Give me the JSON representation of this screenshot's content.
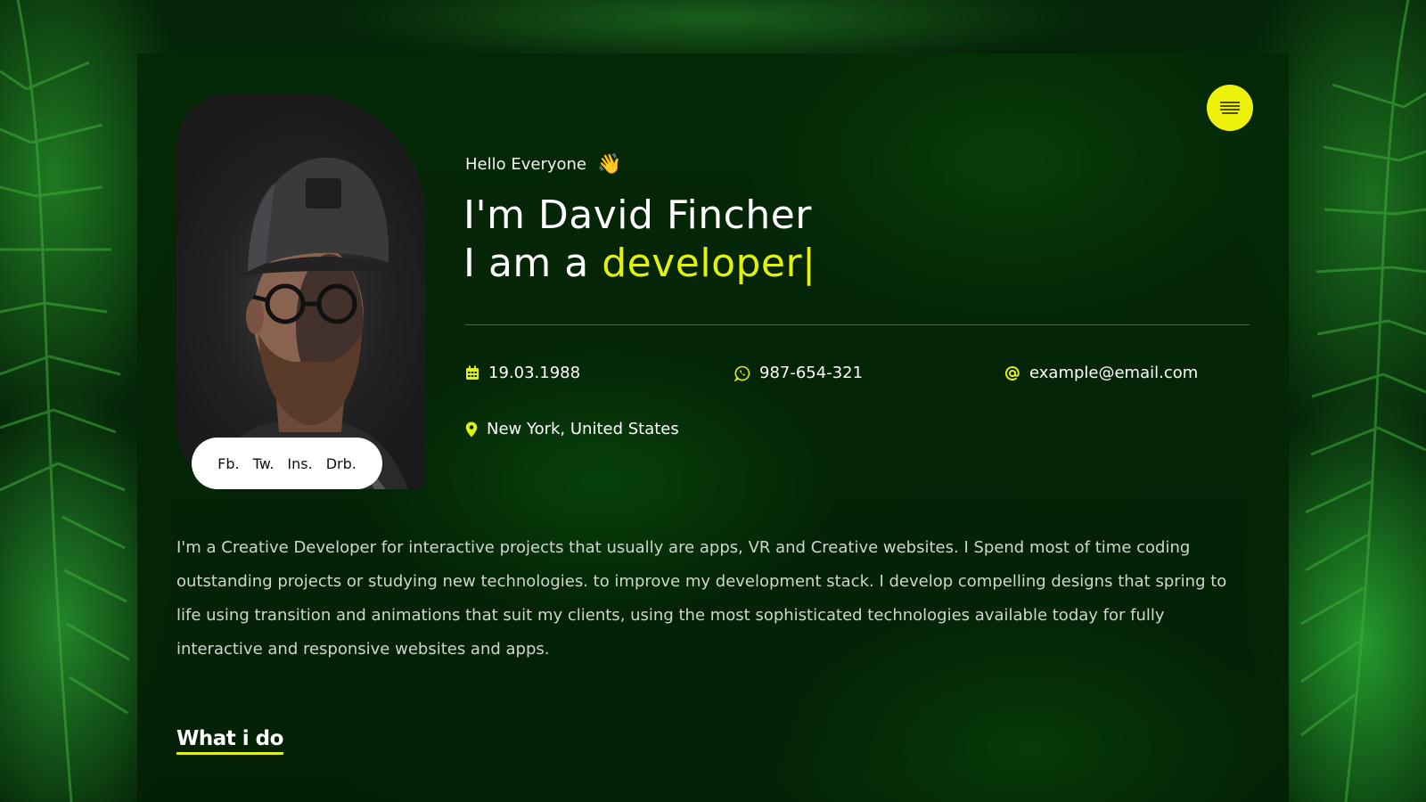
{
  "colors": {
    "accent": "#e2f20a",
    "menu_button": "#eef20a",
    "background": "#052508"
  },
  "social": {
    "items": [
      "Fb.",
      "Tw.",
      "Ins.",
      "Drb."
    ]
  },
  "hero": {
    "greeting": "Hello Everyone",
    "greeting_emoji": "👋",
    "name_line": "I'm David Fincher",
    "role_prefix": "I am a ",
    "role_word": "developer|"
  },
  "contact": {
    "birthdate": "19.03.1988",
    "phone": "987-654-321",
    "email": "example@email.com",
    "location": "New York, United States"
  },
  "icons": {
    "birthdate": "calendar-icon",
    "phone": "whatsapp-icon",
    "email": "at-icon",
    "location": "map-pin-icon",
    "menu": "hamburger-menu-icon"
  },
  "about": {
    "text": "I'm a Creative Developer for interactive projects that usually are apps, VR and Creative websites. I Spend most of time coding outstanding projects or studying new technologies. to improve my development stack. I develop compelling designs that spring to life using transition and animations that suit my clients, using the most sophisticated technologies available today for fully interactive and responsive websites and apps."
  },
  "sections": {
    "what_i_do_title": "What i do"
  }
}
